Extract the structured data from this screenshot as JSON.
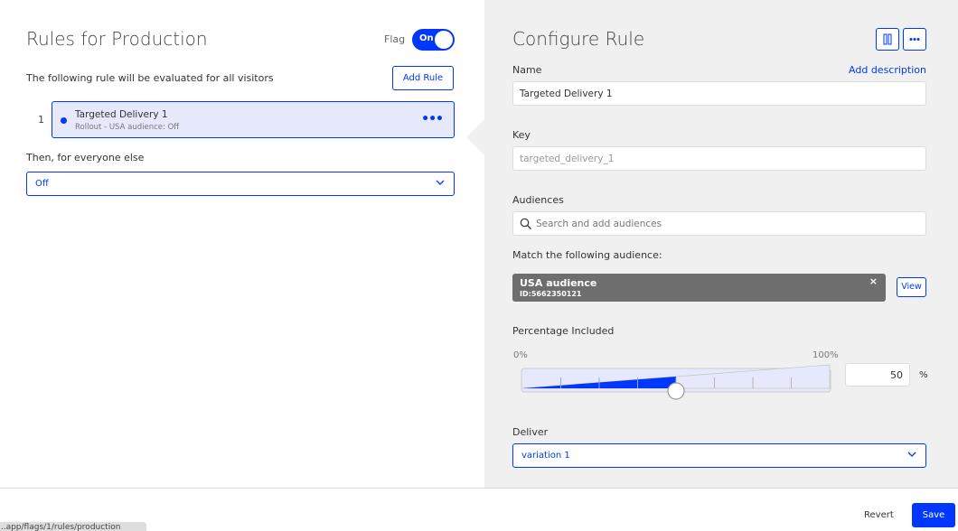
{
  "left": {
    "title": "Rules for Production",
    "flag_label": "Flag",
    "flag_toggle": "On",
    "eval_text": "The following rule will be evaluated for all visitors",
    "add_rule": "Add Rule",
    "rules": [
      {
        "number": "1",
        "name": "Targeted Delivery 1",
        "subtitle": "Rollout - USA audience: Off"
      }
    ],
    "else_label": "Then, for everyone else",
    "else_value": "Off"
  },
  "right": {
    "title": "Configure Rule",
    "name_label": "Name",
    "add_description": "Add description",
    "name_value": "Targeted Delivery 1",
    "key_label": "Key",
    "key_placeholder": "targeted_delivery_1",
    "audiences_label": "Audiences",
    "audiences_placeholder": "Search and add audiences",
    "match_label": "Match the following audience:",
    "audience_chip": {
      "name": "USA audience",
      "id": "ID:5662350121",
      "close": "×"
    },
    "view_label": "View",
    "percentage_label": "Percentage Included",
    "pct_min": "0%",
    "pct_max": "100%",
    "percentage_value": 50,
    "pct_sign": "%",
    "deliver_label": "Deliver",
    "deliver_value": "variation 1"
  },
  "footer": {
    "url_text": "...app/flags/1/rules/production",
    "revert": "Revert",
    "save": "Save"
  },
  "colors": {
    "accent": "#0037ff",
    "panel": "#f0f0f0",
    "rule_bg": "#e5e9fb",
    "chip": "#6e6e6e"
  },
  "icons": [
    "columns-icon",
    "more-horizontal-icon",
    "search-icon",
    "chevron-down-icon",
    "close-icon"
  ]
}
